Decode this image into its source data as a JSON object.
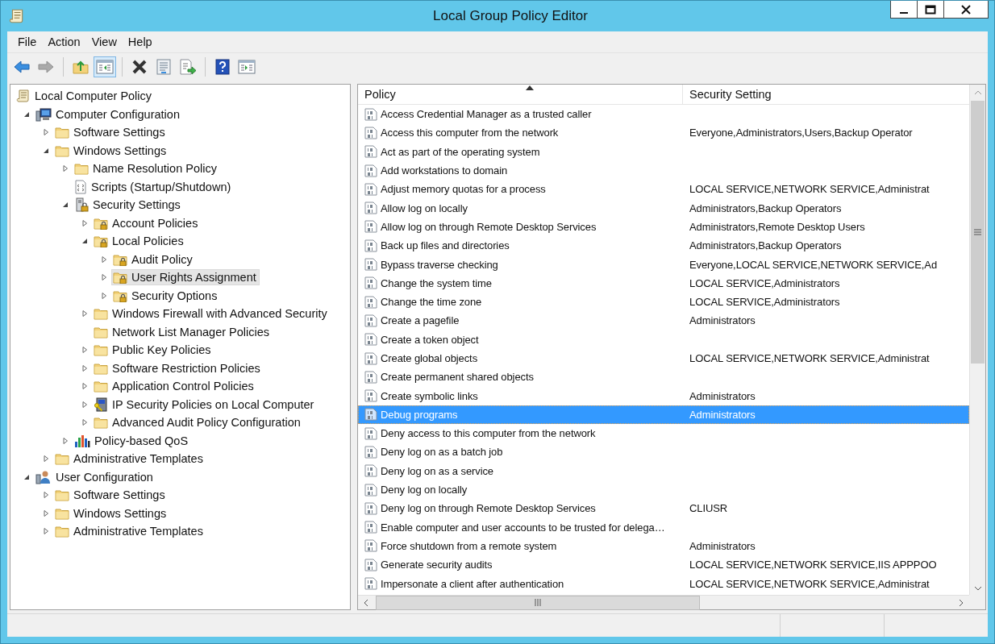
{
  "window": {
    "title": "Local Group Policy Editor"
  },
  "menu": [
    {
      "label": "File"
    },
    {
      "label": "Action"
    },
    {
      "label": "View"
    },
    {
      "label": "Help"
    }
  ],
  "toolbar": [
    {
      "kind": "back",
      "disabled": false,
      "pressed": false
    },
    {
      "kind": "forward",
      "disabled": true,
      "pressed": false
    },
    {
      "kind": "separator"
    },
    {
      "kind": "up",
      "disabled": false,
      "pressed": false
    },
    {
      "kind": "tree-toggle",
      "disabled": false,
      "pressed": true
    },
    {
      "kind": "separator"
    },
    {
      "kind": "delete",
      "disabled": false,
      "pressed": false
    },
    {
      "kind": "properties",
      "disabled": false,
      "pressed": false
    },
    {
      "kind": "export",
      "disabled": false,
      "pressed": false
    },
    {
      "kind": "separator"
    },
    {
      "kind": "help",
      "disabled": false,
      "pressed": false
    },
    {
      "kind": "action-toggle",
      "disabled": false,
      "pressed": false
    }
  ],
  "tree": {
    "label": "Local Computer Policy",
    "kind": "scroll",
    "selected": false,
    "children": [
      {
        "label": "Computer Configuration",
        "kind": "computer",
        "expanded": true,
        "selected": false,
        "children": [
          {
            "label": "Software Settings",
            "kind": "folder",
            "expanded": false,
            "selected": false
          },
          {
            "label": "Windows Settings",
            "kind": "folder",
            "expanded": true,
            "selected": false,
            "children": [
              {
                "label": "Name Resolution Policy",
                "kind": "folder",
                "expanded": false,
                "selected": false
              },
              {
                "label": "Scripts (Startup/Shutdown)",
                "kind": "script",
                "selected": false
              },
              {
                "label": "Security Settings",
                "kind": "server-lock",
                "expanded": true,
                "selected": false,
                "children": [
                  {
                    "label": "Account Policies",
                    "kind": "lock-folder",
                    "expanded": false,
                    "selected": false
                  },
                  {
                    "label": "Local Policies",
                    "kind": "lock-folder",
                    "expanded": true,
                    "selected": false,
                    "children": [
                      {
                        "label": "Audit Policy",
                        "kind": "lock-folder",
                        "expanded": false,
                        "selected": false
                      },
                      {
                        "label": "User Rights Assignment",
                        "kind": "lock-folder",
                        "expanded": false,
                        "selected": true
                      },
                      {
                        "label": "Security Options",
                        "kind": "lock-folder",
                        "expanded": false,
                        "selected": false
                      }
                    ]
                  },
                  {
                    "label": "Windows Firewall with Advanced Security",
                    "kind": "folder",
                    "expanded": false,
                    "selected": false
                  },
                  {
                    "label": "Network List Manager Policies",
                    "kind": "folder",
                    "selected": false
                  },
                  {
                    "label": "Public Key Policies",
                    "kind": "folder",
                    "expanded": false,
                    "selected": false
                  },
                  {
                    "label": "Software Restriction Policies",
                    "kind": "folder",
                    "expanded": false,
                    "selected": false
                  },
                  {
                    "label": "Application Control Policies",
                    "kind": "folder",
                    "expanded": false,
                    "selected": false
                  },
                  {
                    "label": "IP Security Policies on Local Computer",
                    "kind": "ip-security",
                    "expanded": false,
                    "selected": false
                  },
                  {
                    "label": "Advanced Audit Policy Configuration",
                    "kind": "folder",
                    "expanded": false,
                    "selected": false
                  }
                ]
              },
              {
                "label": "Policy-based QoS",
                "kind": "qos",
                "expanded": false,
                "selected": false
              }
            ]
          },
          {
            "label": "Administrative Templates",
            "kind": "folder",
            "expanded": false,
            "selected": false
          }
        ]
      },
      {
        "label": "User Configuration",
        "kind": "user",
        "expanded": true,
        "selected": false,
        "children": [
          {
            "label": "Software Settings",
            "kind": "folder",
            "expanded": false,
            "selected": false
          },
          {
            "label": "Windows Settings",
            "kind": "folder",
            "expanded": false,
            "selected": false
          },
          {
            "label": "Administrative Templates",
            "kind": "folder",
            "expanded": false,
            "selected": false
          }
        ]
      }
    ]
  },
  "table": {
    "columns": [
      {
        "label": "Policy",
        "sorted": true
      },
      {
        "label": "Security Setting",
        "sorted": false
      }
    ],
    "rows": [
      {
        "policy": "Access Credential Manager as a trusted caller",
        "setting": "",
        "selected": false
      },
      {
        "policy": "Access this computer from the network",
        "setting": "Everyone,Administrators,Users,Backup Operator",
        "selected": false
      },
      {
        "policy": "Act as part of the operating system",
        "setting": "",
        "selected": false
      },
      {
        "policy": "Add workstations to domain",
        "setting": "",
        "selected": false
      },
      {
        "policy": "Adjust memory quotas for a process",
        "setting": "LOCAL SERVICE,NETWORK SERVICE,Administrat",
        "selected": false
      },
      {
        "policy": "Allow log on locally",
        "setting": "Administrators,Backup Operators",
        "selected": false
      },
      {
        "policy": "Allow log on through Remote Desktop Services",
        "setting": "Administrators,Remote Desktop Users",
        "selected": false
      },
      {
        "policy": "Back up files and directories",
        "setting": "Administrators,Backup Operators",
        "selected": false
      },
      {
        "policy": "Bypass traverse checking",
        "setting": "Everyone,LOCAL SERVICE,NETWORK SERVICE,Ad",
        "selected": false
      },
      {
        "policy": "Change the system time",
        "setting": "LOCAL SERVICE,Administrators",
        "selected": false
      },
      {
        "policy": "Change the time zone",
        "setting": "LOCAL SERVICE,Administrators",
        "selected": false
      },
      {
        "policy": "Create a pagefile",
        "setting": "Administrators",
        "selected": false
      },
      {
        "policy": "Create a token object",
        "setting": "",
        "selected": false
      },
      {
        "policy": "Create global objects",
        "setting": "LOCAL SERVICE,NETWORK SERVICE,Administrat",
        "selected": false
      },
      {
        "policy": "Create permanent shared objects",
        "setting": "",
        "selected": false
      },
      {
        "policy": "Create symbolic links",
        "setting": "Administrators",
        "selected": false
      },
      {
        "policy": "Debug programs",
        "setting": "Administrators",
        "selected": true
      },
      {
        "policy": "Deny access to this computer from the network",
        "setting": "",
        "selected": false
      },
      {
        "policy": "Deny log on as a batch job",
        "setting": "",
        "selected": false
      },
      {
        "policy": "Deny log on as a service",
        "setting": "",
        "selected": false
      },
      {
        "policy": "Deny log on locally",
        "setting": "",
        "selected": false
      },
      {
        "policy": "Deny log on through Remote Desktop Services",
        "setting": "CLIUSR",
        "selected": false
      },
      {
        "policy": "Enable computer and user accounts to be trusted for delega…",
        "setting": "",
        "selected": false
      },
      {
        "policy": "Force shutdown from a remote system",
        "setting": "Administrators",
        "selected": false
      },
      {
        "policy": "Generate security audits",
        "setting": "LOCAL SERVICE,NETWORK SERVICE,IIS APPPOO",
        "selected": false
      },
      {
        "policy": "Impersonate a client after authentication",
        "setting": "LOCAL SERVICE,NETWORK SERVICE,Administrat",
        "selected": false
      }
    ]
  }
}
